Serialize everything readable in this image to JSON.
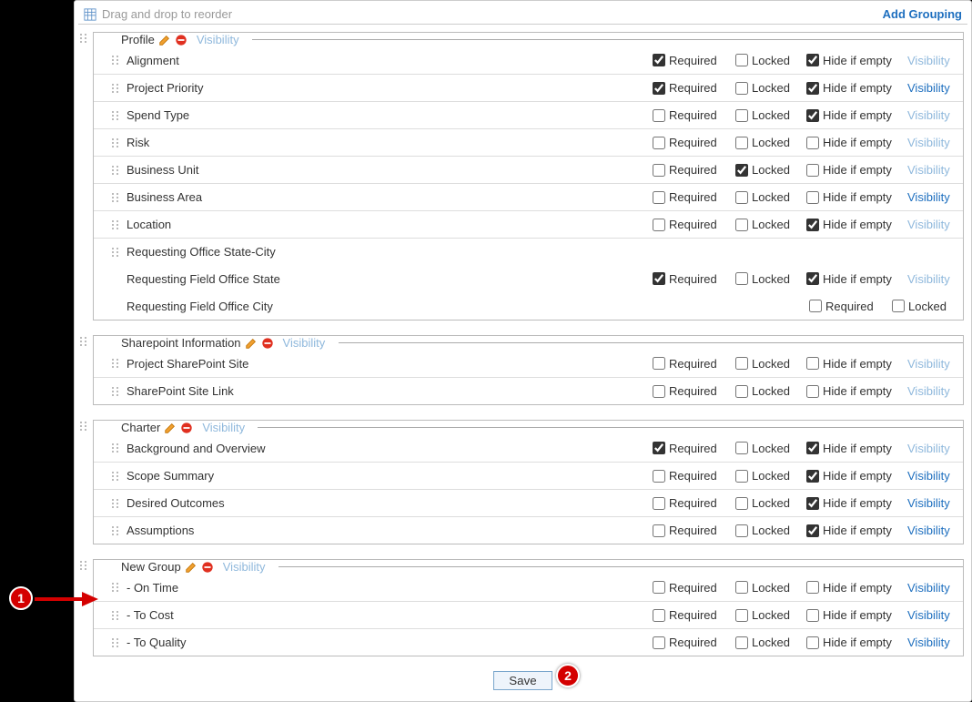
{
  "topbar": {
    "hint": "Drag and drop to reorder",
    "add_grouping": "Add Grouping"
  },
  "labels": {
    "required": "Required",
    "locked": "Locked",
    "hide_if_empty": "Hide if empty",
    "visibility": "Visibility",
    "save": "Save"
  },
  "annotations": {
    "badge1": "1",
    "badge2": "2"
  },
  "groups": [
    {
      "title": "Profile",
      "items": [
        {
          "name": "Alignment",
          "required": true,
          "locked": false,
          "hide": true,
          "vis_muted": true
        },
        {
          "name": "Project Priority",
          "required": true,
          "locked": false,
          "hide": true,
          "vis_muted": false
        },
        {
          "name": "Spend Type",
          "required": false,
          "locked": false,
          "hide": true,
          "vis_muted": true
        },
        {
          "name": "Risk",
          "required": false,
          "locked": false,
          "hide": false,
          "vis_muted": true
        },
        {
          "name": "Business Unit",
          "required": false,
          "locked": true,
          "hide": false,
          "vis_muted": true
        },
        {
          "name": "Business Area",
          "required": false,
          "locked": false,
          "hide": false,
          "vis_muted": false
        },
        {
          "name": "Location",
          "required": false,
          "locked": false,
          "hide": true,
          "vis_muted": true
        },
        {
          "name": "Requesting Office State-City",
          "subitems": [
            {
              "name": "Requesting Field Office State",
              "required": true,
              "locked": false,
              "hide": true,
              "vis_muted": true,
              "show_hide": true
            },
            {
              "name": "Requesting Field Office City",
              "required": false,
              "locked": false,
              "show_hide": false
            }
          ]
        }
      ]
    },
    {
      "title": "Sharepoint Information",
      "items": [
        {
          "name": "Project SharePoint Site",
          "required": false,
          "locked": false,
          "hide": false,
          "vis_muted": true
        },
        {
          "name": "SharePoint Site Link",
          "required": false,
          "locked": false,
          "hide": false,
          "vis_muted": true
        }
      ]
    },
    {
      "title": "Charter",
      "items": [
        {
          "name": "Background and Overview",
          "required": true,
          "locked": false,
          "hide": true,
          "vis_muted": true
        },
        {
          "name": "Scope Summary",
          "required": false,
          "locked": false,
          "hide": true,
          "vis_muted": false
        },
        {
          "name": "Desired Outcomes",
          "required": false,
          "locked": false,
          "hide": true,
          "vis_muted": false
        },
        {
          "name": "Assumptions",
          "required": false,
          "locked": false,
          "hide": true,
          "vis_muted": false
        }
      ]
    },
    {
      "title": "New Group",
      "items": [
        {
          "name": " - On Time",
          "required": false,
          "locked": false,
          "hide": false,
          "vis_muted": false
        },
        {
          "name": " - To Cost",
          "required": false,
          "locked": false,
          "hide": false,
          "vis_muted": false
        },
        {
          "name": " - To Quality",
          "required": false,
          "locked": false,
          "hide": false,
          "vis_muted": false
        }
      ]
    }
  ]
}
